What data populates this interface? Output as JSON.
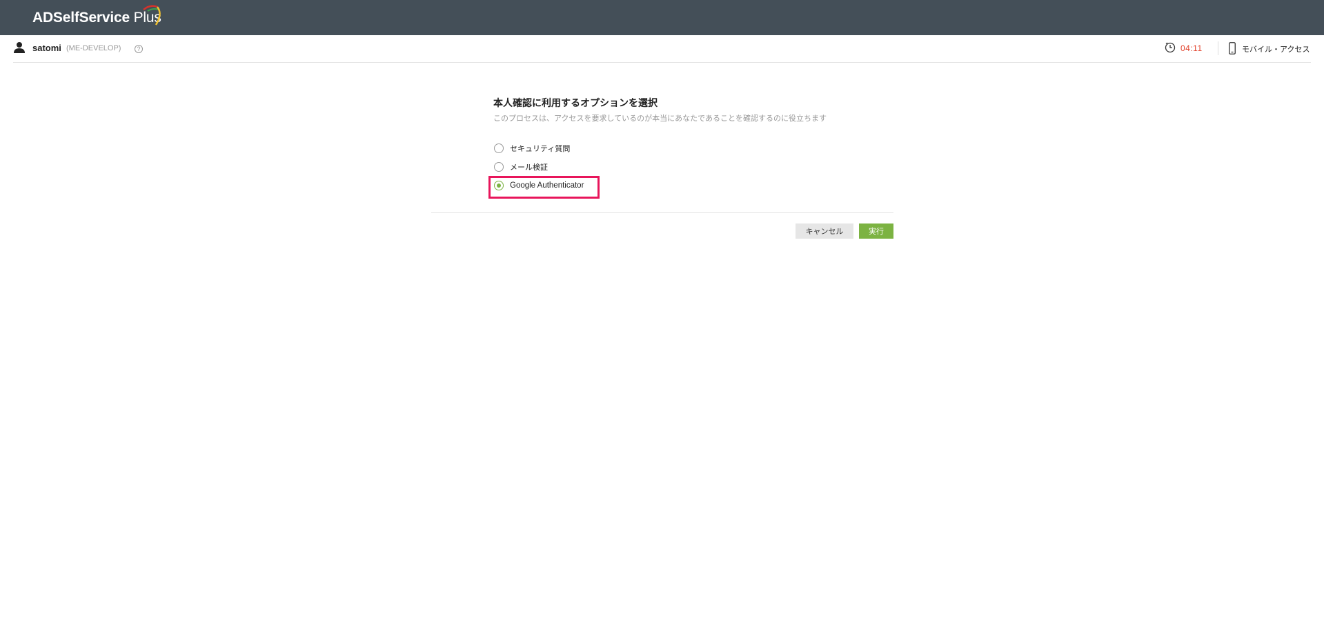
{
  "header": {
    "logo_bold": "ADSelfService",
    "logo_light": "Plus"
  },
  "userbar": {
    "username": "satomi",
    "domain": "(ME-DEVELOP)",
    "help_glyph": "?",
    "timer": "04:11",
    "mobile_access": "モバイル・アクセス"
  },
  "main": {
    "title": "本人確認に利用するオプションを選択",
    "subtitle": "このプロセスは、アクセスを要求しているのが本当にあなたであることを確認するのに役立ちます",
    "options": [
      {
        "label": "セキュリティ質問",
        "selected": false
      },
      {
        "label": "メール検証",
        "selected": false
      },
      {
        "label": "Google Authenticator",
        "selected": true
      }
    ],
    "cancel_label": "キャンセル",
    "run_label": "実行"
  },
  "colors": {
    "topbar": "#444f58",
    "accent_green": "#7cb342",
    "timer_red": "#e2412b",
    "highlight_pink": "#e8155b"
  },
  "icons": [
    "user-icon",
    "help-icon",
    "clock-icon",
    "mobile-icon"
  ]
}
